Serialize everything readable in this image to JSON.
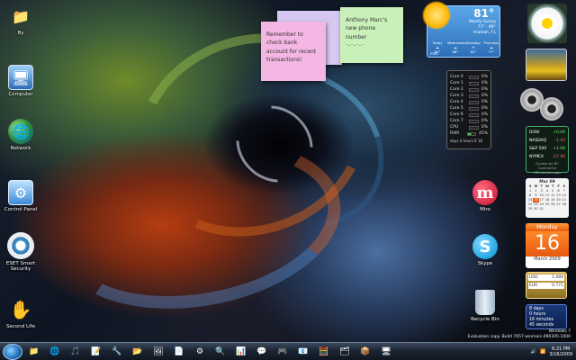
{
  "desktop": {
    "icons": [
      {
        "label": "By",
        "glyph": "📁",
        "color": "#d9a331"
      },
      {
        "label": "Computer",
        "glyph": "🖥",
        "color": "#3a79c2"
      },
      {
        "label": "Network",
        "glyph": "🌐",
        "color": "#2d7fd0"
      },
      {
        "label": "Control Panel",
        "glyph": "⚙",
        "color": "#4a8fd6"
      },
      {
        "label": "ESET Smart Security",
        "glyph": "◉",
        "color": "#e0e8f0"
      },
      {
        "label": "Second Life",
        "glyph": "✋",
        "color": "#e8e8e8"
      },
      {
        "label": "Miro",
        "glyph": "m",
        "color": "#c8102e"
      },
      {
        "label": "Skype",
        "glyph": "S",
        "color": "#00aff0"
      },
      {
        "label": "Recycle Bin",
        "glyph": "🗑",
        "color": "#b8c8d8"
      }
    ]
  },
  "notes": {
    "note1": "Remember to check bank account for recent transactions!",
    "note2": "Anthony Marc's new phone number",
    "note2_num": "·-·-·-·"
  },
  "weather": {
    "temp": "81°",
    "condition": "Mostly Sunny",
    "hilo1": "77°",
    "hilo2": "89°",
    "city": "Hialeah, FL",
    "days": [
      "Today",
      "Wednesday",
      "Tuesday",
      "Thursday"
    ],
    "temps": [
      "84°",
      "88°",
      "82°",
      "77°"
    ],
    "brand": "msn"
  },
  "cpu_meter": {
    "rows": [
      {
        "label": "Core 0",
        "value": "0%"
      },
      {
        "label": "Core 1",
        "value": "0%"
      },
      {
        "label": "Core 2",
        "value": "0%"
      },
      {
        "label": "Core 3",
        "value": "0%"
      },
      {
        "label": "Core 4",
        "value": "0%"
      },
      {
        "label": "Core 5",
        "value": "0%"
      },
      {
        "label": "Core 6",
        "value": "0%"
      },
      {
        "label": "Core 7",
        "value": "0%"
      },
      {
        "label": "CPU",
        "value": "0%"
      },
      {
        "label": "RAM",
        "value": "45%"
      }
    ],
    "uptime": "days 0 hours 0 18"
  },
  "stocks": {
    "rows": [
      {
        "sym": "DOW",
        "val": "+0.09",
        "color": "#7ee07e"
      },
      {
        "sym": "NASDAQ",
        "val": "-1.43",
        "color": "#ff7070"
      },
      {
        "sym": "S&P 500",
        "val": "+1.08",
        "color": "#7ee07e"
      },
      {
        "sym": "NYMEX",
        "val": "-27.40",
        "color": "#ff7070"
      }
    ],
    "footer": "Quotes by BC Commerce",
    "footer2": "18 minutes ago"
  },
  "calendar_small": {
    "month": "Mar 09",
    "day_names": [
      "S",
      "M",
      "T",
      "W",
      "T",
      "F",
      "S"
    ],
    "weeks": [
      [
        "1",
        "2",
        "3",
        "4",
        "5",
        "6",
        "7"
      ],
      [
        "8",
        "9",
        "10",
        "11",
        "12",
        "13",
        "14"
      ],
      [
        "15",
        "16",
        "17",
        "18",
        "19",
        "20",
        "21"
      ],
      [
        "22",
        "23",
        "24",
        "25",
        "26",
        "27",
        "28"
      ],
      [
        "29",
        "30",
        "31",
        "",
        "",
        "",
        ""
      ]
    ]
  },
  "calendar_big": {
    "weekday": "Monday",
    "day": "16",
    "month_year": "March 2009"
  },
  "currency": {
    "rows": [
      {
        "code": "USD",
        "val": "1.089"
      },
      {
        "code": "EUR",
        "val": "0.771"
      }
    ]
  },
  "countdown": {
    "lines": [
      "8 days",
      "0 hours",
      "16 minutes",
      "45 seconds"
    ]
  },
  "watermark": {
    "line1": "Windows 7",
    "line2": "Evaluation copy. Build 7057.winmain.090305-1000"
  },
  "taskbar": {
    "items": [
      "📁",
      "🌐",
      "🎵",
      "📝",
      "🔧",
      "📂",
      "🖼",
      "📄",
      "⚙",
      "🔍",
      "📊",
      "💬",
      "🎮",
      "📧",
      "🧮",
      "🗂",
      "📦",
      "🖥"
    ],
    "clock_time": "6:21 PM",
    "clock_date": "3/16/2009"
  }
}
